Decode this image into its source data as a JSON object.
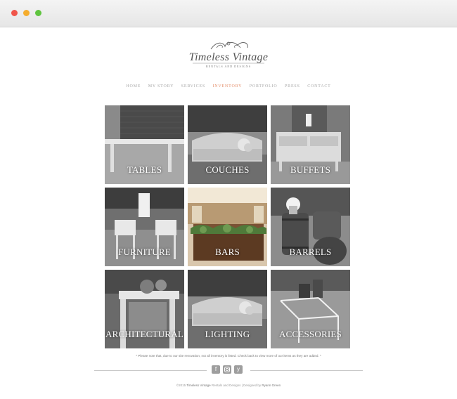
{
  "window": {
    "buttons": [
      "close",
      "minimize",
      "maximize"
    ]
  },
  "logo": {
    "title": "Timeless Vintage",
    "subtitle": "RENTALS AND DESIGNS"
  },
  "nav": {
    "items": [
      "HOME",
      "MY STORY",
      "SERVICES",
      "INVENTORY",
      "PORTFOLIO",
      "PRESS",
      "CONTACT"
    ],
    "active": "INVENTORY",
    "active_color": "#e58f6c"
  },
  "inventory": {
    "tiles": [
      {
        "label": "TABLES"
      },
      {
        "label": "COUCHES"
      },
      {
        "label": "BUFFETS"
      },
      {
        "label": "FURNITURE"
      },
      {
        "label": "BARS"
      },
      {
        "label": "BARRELS"
      },
      {
        "label": "ARCHITECTURAL"
      },
      {
        "label": "LIGHTING"
      },
      {
        "label": "ACCESSORIES"
      }
    ]
  },
  "note": "* Please note that, due to our site renovation, not all inventory is listed. Check back to view more of our items as they are added. *",
  "social": {
    "icons": [
      "facebook-icon",
      "instagram-icon",
      "yelp-icon"
    ]
  },
  "footer": {
    "prefix": "©2015",
    "brand": "Timeless Vintage",
    "middle": "Rentals and Designs | Designed by",
    "designer": "Ryann Green"
  }
}
